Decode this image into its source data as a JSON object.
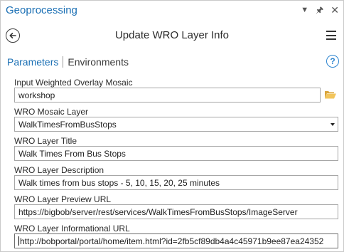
{
  "pane": {
    "title": "Geoprocessing",
    "window_controls": [
      "chevron-down-icon",
      "pin-icon",
      "close-icon"
    ]
  },
  "header": {
    "tool_title": "Update WRO Layer Info",
    "back_icon": "back-arrow-circle-icon",
    "menu_icon": "hamburger-menu-icon"
  },
  "tabs": {
    "parameters": "Parameters",
    "environments": "Environments",
    "help_symbol": "?"
  },
  "colors": {
    "accent": "#1a6fb4",
    "help": "#2f86d0",
    "folder": "#e8b84a"
  },
  "form": {
    "input_mosaic": {
      "label": "Input Weighted Overlay Mosaic",
      "value": "workshop"
    },
    "mosaic_layer": {
      "label": "WRO Mosaic Layer",
      "value": "WalkTimesFromBusStops"
    },
    "layer_title": {
      "label": "WRO Layer Title",
      "value": "Walk Times From Bus Stops"
    },
    "layer_description": {
      "label": "WRO Layer Description",
      "value": "Walk times from bus stops - 5, 10, 15, 20, 25 minutes"
    },
    "preview_url": {
      "label": "WRO Layer Preview URL",
      "value": "https://bigbob/server/rest/services/WalkTimesFromBusStops/ImageServer"
    },
    "informational_url": {
      "label": "WRO Layer Informational URL",
      "value": "http://bobportal/portal/home/item.html?id=2fb5cf89db4a4c45971b9ee87ea24352"
    }
  }
}
